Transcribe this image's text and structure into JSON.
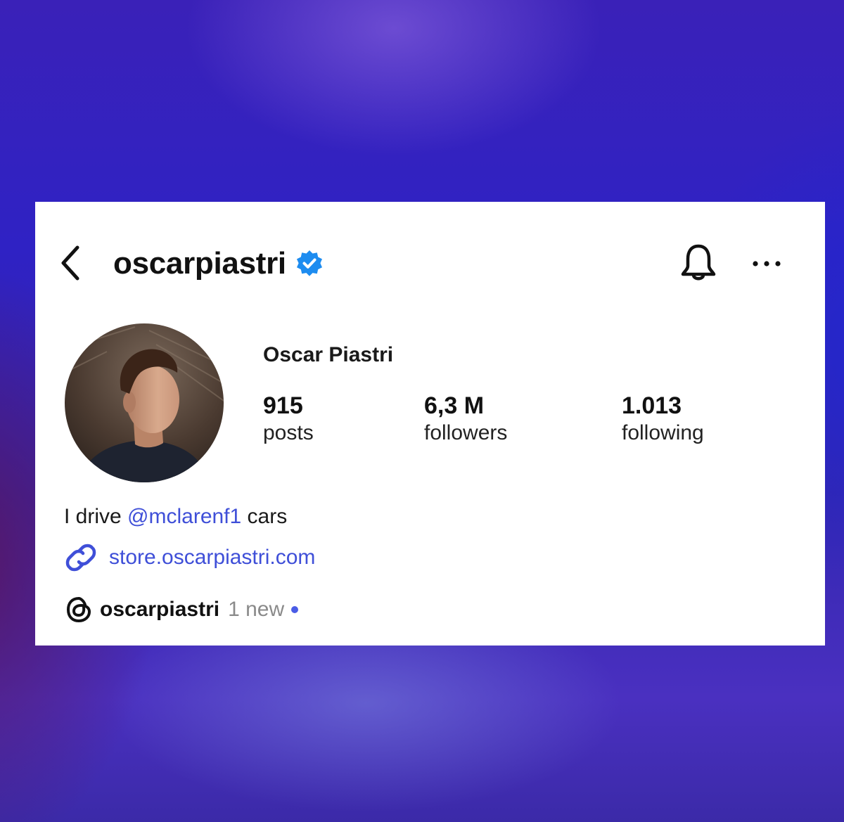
{
  "colors": {
    "card_background": "#ffffff",
    "link_blue": "#3f4fd8",
    "verified_blue": "#1d8cf0",
    "muted_text": "#8a8a8a",
    "new_dot": "#4a5ce6"
  },
  "header": {
    "back_icon": "chevron-left-icon",
    "username": "oscarpiastri",
    "verified_icon": "verified-badge-icon",
    "bell_icon": "bell-icon",
    "more_icon": "ellipsis-icon"
  },
  "profile": {
    "avatar_icon": "profile-photo",
    "full_name": "Oscar Piastri",
    "stats": [
      {
        "value": "915",
        "label": "posts"
      },
      {
        "value": "6,3 M",
        "label": "followers"
      },
      {
        "value": "1.013",
        "label": "following"
      }
    ]
  },
  "bio": {
    "prefix": "I drive ",
    "mention": "@mclarenf1",
    "suffix": " cars"
  },
  "link": {
    "icon": "link-icon",
    "text": "store.oscarpiastri.com"
  },
  "threads": {
    "icon": "threads-icon",
    "username": "oscarpiastri",
    "badge": "1 new"
  }
}
